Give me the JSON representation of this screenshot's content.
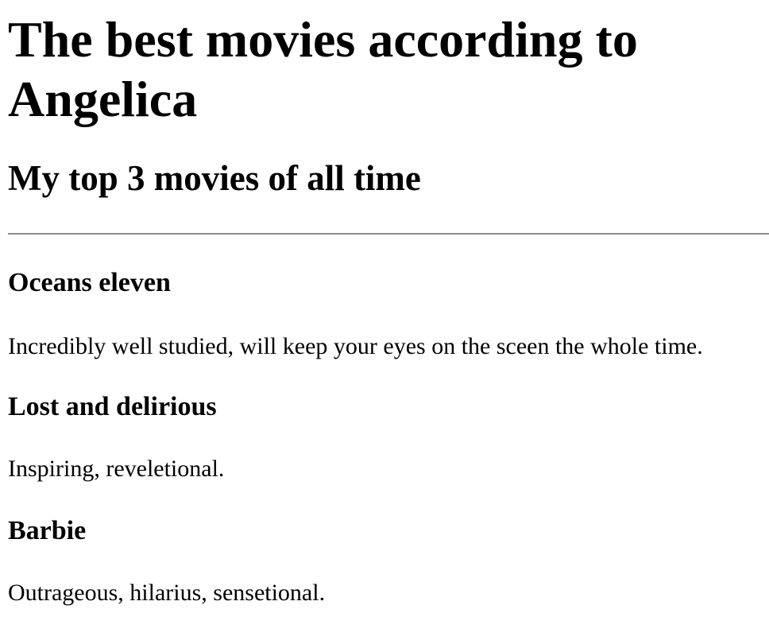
{
  "page": {
    "title": "The best movies according to Angelica",
    "subtitle": "My top 3 movies of all time"
  },
  "movies": [
    {
      "title": "Oceans eleven",
      "description": "Incredibly well studied, will keep your eyes on the sceen the whole time."
    },
    {
      "title": "Lost and delirious",
      "description": "Inspiring, reveletional."
    },
    {
      "title": "Barbie",
      "description": "Outrageous, hilarius, sensetional."
    }
  ],
  "colors": {
    "background": "#ffffff",
    "text": "#000000",
    "divider": "#8c8c8c"
  }
}
